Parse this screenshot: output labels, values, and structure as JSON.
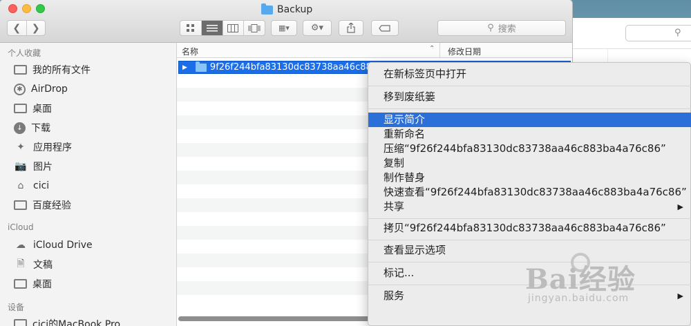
{
  "window": {
    "title": "Backup",
    "search_placeholder": "搜索"
  },
  "sidebar": {
    "sections": [
      {
        "heading": "个人收藏",
        "items": [
          {
            "label": "我的所有文件",
            "icon": "all-files-icon"
          },
          {
            "label": "AirDrop",
            "icon": "airdrop-icon"
          },
          {
            "label": "桌面",
            "icon": "desktop-icon"
          },
          {
            "label": "下载",
            "icon": "downloads-icon"
          },
          {
            "label": "应用程序",
            "icon": "applications-icon"
          },
          {
            "label": "图片",
            "icon": "pictures-icon"
          },
          {
            "label": "cici",
            "icon": "home-icon"
          },
          {
            "label": "百度经验",
            "icon": "folder-icon"
          }
        ]
      },
      {
        "heading": "iCloud",
        "items": [
          {
            "label": "iCloud Drive",
            "icon": "cloud-icon"
          },
          {
            "label": "文稿",
            "icon": "documents-icon"
          },
          {
            "label": "桌面",
            "icon": "desktop-icon"
          }
        ]
      },
      {
        "heading": "设备",
        "items": [
          {
            "label": "cici的MacBook Pro",
            "icon": "laptop-icon"
          }
        ]
      }
    ]
  },
  "list": {
    "columns": {
      "name": "名称",
      "date": "修改日期"
    },
    "selected_item": "9f26f244bfa83130dc83738aa46c883ba4a76c86"
  },
  "context_menu": {
    "items": [
      {
        "label": "在新标签页中打开"
      },
      {
        "label": "移到废纸篓"
      },
      {
        "label": "显示简介",
        "highlighted": true
      },
      {
        "label": "重新命名"
      },
      {
        "label": "压缩“9f26f244bfa83130dc83738aa46c883ba4a76c86”"
      },
      {
        "label": "复制"
      },
      {
        "label": "制作替身"
      },
      {
        "label": "快速查看“9f26f244bfa83130dc83738aa46c883ba4a76c86”"
      },
      {
        "label": "共享",
        "submenu": true
      },
      {
        "label": "拷贝“9f26f244bfa83130dc83738aa46c883ba4a76c86”"
      },
      {
        "label": "查看显示选项"
      },
      {
        "label": "标记..."
      },
      {
        "label": "服务",
        "submenu": true
      }
    ]
  },
  "background_window": {
    "search_icon": "search-icon"
  },
  "watermark": {
    "brand": "Bai经验",
    "url": "jingyan.baidu.com"
  },
  "colors": {
    "highlight": "#2b6fd9",
    "selection": "#1b6ee8"
  }
}
